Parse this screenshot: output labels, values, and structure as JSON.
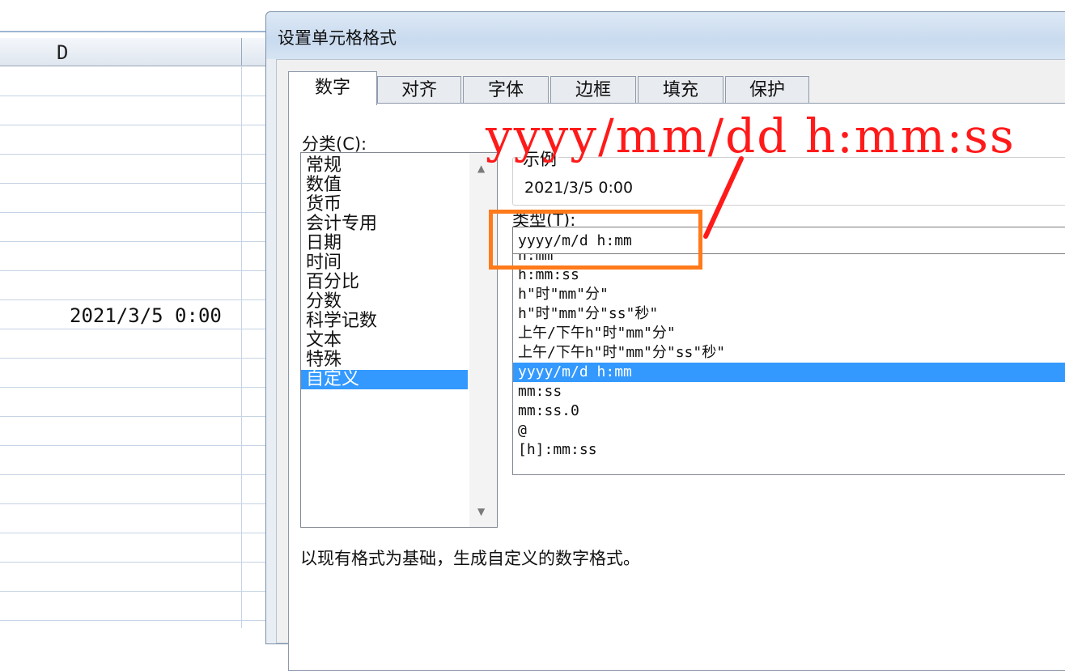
{
  "sheet": {
    "column_label": "D",
    "cell_value": "2021/3/5 0:00"
  },
  "dialog": {
    "title": "设置单元格格式",
    "tabs": [
      "数字",
      "对齐",
      "字体",
      "边框",
      "填充",
      "保护"
    ],
    "active_tab": "数字",
    "category_label": "分类(C):",
    "categories": [
      "常规",
      "数值",
      "货币",
      "会计专用",
      "日期",
      "时间",
      "百分比",
      "分数",
      "科学记数",
      "文本",
      "特殊",
      "自定义"
    ],
    "selected_category": "自定义",
    "sample_label": "示例",
    "sample_value": "2021/3/5 0:00",
    "type_label": "类型(T):",
    "type_value": "yyyy/m/d h:mm",
    "type_options": [
      "h:mm",
      "h:mm:ss",
      "h\"时\"mm\"分\"",
      "h\"时\"mm\"分\"ss\"秒\"",
      "上午/下午h\"时\"mm\"分\"",
      "上午/下午h\"时\"mm\"分\"ss\"秒\"",
      "yyyy/m/d h:mm",
      "mm:ss",
      "mm:ss.0",
      "@",
      "[h]:mm:ss"
    ],
    "selected_type": "yyyy/m/d h:mm",
    "description": "以现有格式为基础，生成自定义的数字格式。"
  },
  "annotation": {
    "text": "yyyy/mm/dd h:mm:ss"
  },
  "colors": {
    "selection": "#3399ff",
    "annotation_red": "#ff1a1a",
    "annotation_orange": "#ff7a1a"
  }
}
